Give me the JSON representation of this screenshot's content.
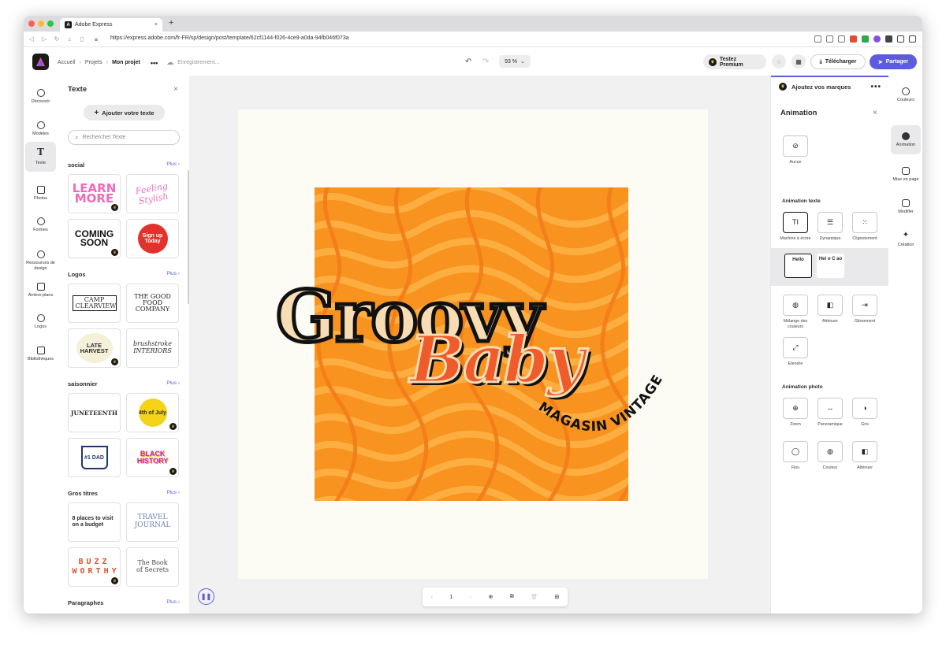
{
  "browser": {
    "tab_title": "Adobe Express",
    "url": "https://express.adobe.com/fr-FR/sp/design/post/template/62cf1144-f026-4ce9-a0da-94fb046f073a"
  },
  "header": {
    "crumbs": [
      "Accueil",
      "Projets",
      "Mon projet"
    ],
    "more": "•••",
    "saving": "Enregistrement...",
    "zoom": "93 %",
    "premium": "Testez Premium",
    "download": "Télécharger",
    "share": "Partager"
  },
  "rail": [
    {
      "label": "Découvrir"
    },
    {
      "label": "Modèles"
    },
    {
      "label": "Texte"
    },
    {
      "label": "Photos"
    },
    {
      "label": "Formes"
    },
    {
      "label": "Ressources de design"
    },
    {
      "label": "Arrière-plans"
    },
    {
      "label": "Logos"
    },
    {
      "label": "Bibliothèques"
    }
  ],
  "text_panel": {
    "title": "Texte",
    "add_button": "Ajouter votre texte",
    "search_placeholder": "Rechercher Texte",
    "more": "Plus",
    "sections": [
      {
        "title": "social",
        "cards": [
          "LEARN MORE",
          "Feeling Stylish",
          "COMING SOON",
          "Sign up Today"
        ]
      },
      {
        "title": "Logos",
        "cards": [
          "CAMP CLEARVIEW",
          "THE GOOD FOOD COMPANY",
          "LATE HARVEST",
          "brushstroke INTERIORS"
        ]
      },
      {
        "title": "saisonnier",
        "cards": [
          "JUNETEENTH",
          "4th of July",
          "#1 DAD",
          "BLACK HISTORY"
        ]
      },
      {
        "title": "Gros titres",
        "cards": [
          "8 places to visit on a budget",
          "TRAVEL JOURNAL",
          "BUZZ WORTHY",
          "The Book of Secrets"
        ]
      },
      {
        "title": "Paragraphes",
        "cards": []
      }
    ]
  },
  "canvas": {
    "title": "Groovy",
    "subtitle": "Baby",
    "tagline": "MAGASIN VINTAGE",
    "page_number": "1"
  },
  "right_panel": {
    "brand": "Ajoutez vos marques",
    "title": "Animation",
    "none": "Aucun",
    "text_anim_label": "Animation texte",
    "text_anims": [
      "Machine à écrire",
      "Dynamique",
      "Clignotement"
    ],
    "sub_options": [
      "Hello",
      "Hel o C ao"
    ],
    "more_anims": [
      "Mélange des couleurs",
      "Atténuer",
      "Glissement",
      "Etendre"
    ],
    "photo_anim_label": "Animation photo",
    "photo_anims": [
      "Zoom",
      "Panoramique",
      "Gris",
      "Flou",
      "Couleur",
      "Atténuer"
    ]
  },
  "far_rail": [
    {
      "label": "Couleurs"
    },
    {
      "label": "Animation"
    },
    {
      "label": "Mise en page"
    },
    {
      "label": "Modifier"
    },
    {
      "label": "Création"
    }
  ],
  "colors": {
    "accent": "#5c5ce0",
    "orange": "#f7931e",
    "baby": "#ef5b2a",
    "cream": "#f7dcb4"
  }
}
